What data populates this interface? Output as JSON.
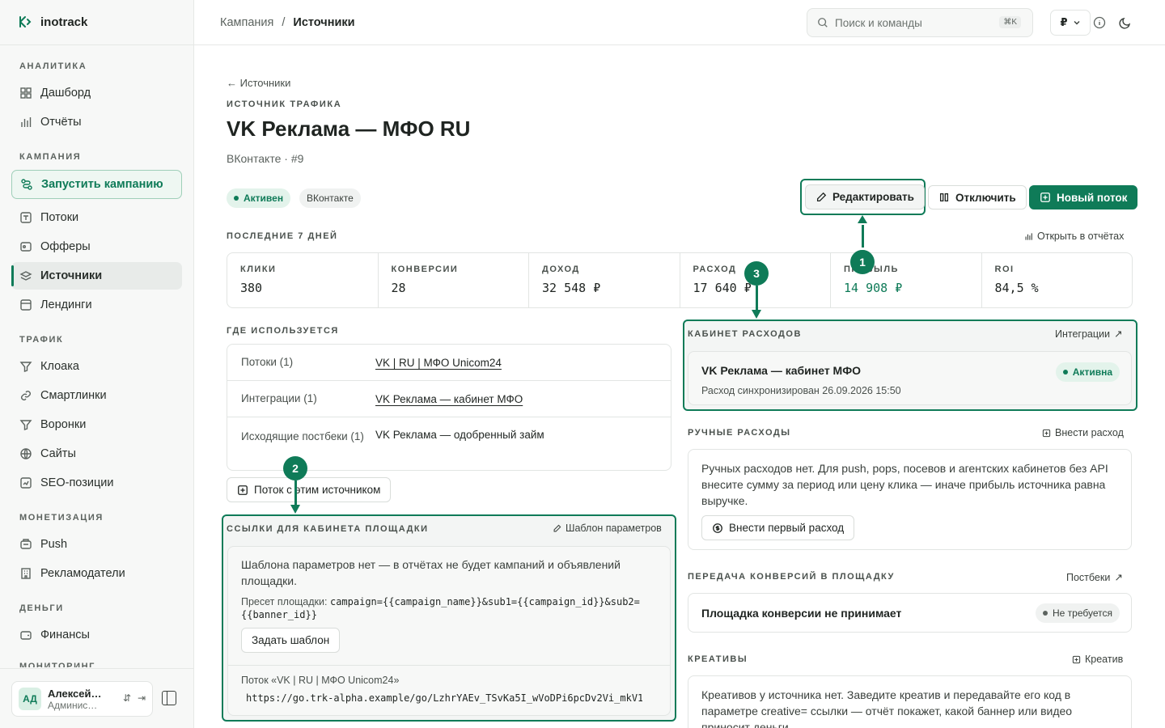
{
  "app": {
    "name": "inotrack"
  },
  "sidebar": {
    "sections": [
      {
        "title": "АНАЛИТИКА"
      },
      {
        "title": "КАМПАНИЯ"
      },
      {
        "title": "ТРАФИК"
      },
      {
        "title": "МОНЕТИЗАЦИЯ"
      },
      {
        "title": "ДЕНЬГИ"
      },
      {
        "title": "МОНИТОРИНГ"
      }
    ],
    "items": {
      "dashboard": "Дашборд",
      "reports": "Отчёты",
      "launch": "Запустить кампанию",
      "flows": "Потоки",
      "offers": "Офферы",
      "sources": "Источники",
      "landings": "Лендинги",
      "cloaking": "Клоака",
      "smartlinks": "Смартлинки",
      "funnels": "Воронки",
      "sites": "Сайты",
      "seo": "SEO-позиции",
      "push": "Push",
      "advertisers": "Рекламодатели",
      "finance": "Финансы"
    },
    "user": {
      "initials": "АД",
      "name": "Алексей…",
      "role": "Админис…"
    }
  },
  "topbar": {
    "breadcrumb": [
      "Кампания",
      "Источники"
    ],
    "search_placeholder": "Поиск и команды",
    "search_shortcut": "⌘K",
    "currency": "₽"
  },
  "page": {
    "back": "Источники",
    "eyebrow": "ИСТОЧНИК ТРАФИКА",
    "title": "VK Реклама — МФО RU",
    "subtitle": "ВКонтакте · #9",
    "badges": {
      "status": "Активен",
      "platform": "ВКонтакте"
    },
    "actions": {
      "edit": "Редактировать",
      "disable": "Отключить",
      "new_flow": "Новый поток"
    }
  },
  "stats": {
    "label": "ПОСЛЕДНИЕ 7 ДНЕЙ",
    "open_reports": "Открыть в отчётах",
    "items": [
      {
        "label": "КЛИКИ",
        "value": "380"
      },
      {
        "label": "КОНВЕРСИИ",
        "value": "28"
      },
      {
        "label": "ДОХОД",
        "value": "32 548 ₽"
      },
      {
        "label": "РАСХОД",
        "value": "17 640 ₽"
      },
      {
        "label": "ПРИБЫЛЬ",
        "value": "14 908 ₽"
      },
      {
        "label": "ROI",
        "value": "84,5 %"
      }
    ]
  },
  "usage": {
    "label": "ГДЕ ИСПОЛЬЗУЕТСЯ",
    "rows": [
      {
        "key": "Потоки (1)",
        "value": "VK | RU | МФО Unicom24"
      },
      {
        "key": "Интеграции (1)",
        "value": "VK Реклама — кабинет МФО"
      },
      {
        "key": "Исходящие постбеки (1)",
        "value": "VK Реклама — одобренный займ"
      }
    ],
    "flow_button": "Поток с этим источником"
  },
  "links": {
    "label": "ССЫЛКИ ДЛЯ КАБИНЕТА ПЛОЩАДКИ",
    "template_link": "Шаблон параметров",
    "empty_text": "Шаблона параметров нет — в отчётах не будет кампаний и объявлений площадки.",
    "preset_label": "Пресет площадки:",
    "preset_value": "campaign={{campaign_name}}&sub1={{campaign_id}}&sub2={{banner_id}}",
    "set_template": "Задать шаблон",
    "flow_label": "Поток «VK | RU | МФО Unicom24»",
    "flow_url": "https://go.trk-alpha.example/go/LzhrYAEv_TSvKa5I_wVoDPi6pcDv2Vi_mkV1…"
  },
  "expense_cabinet": {
    "label": "КАБИНЕТ РАСХОДОВ",
    "link": "Интеграции",
    "name": "VK Реклама — кабинет МФО",
    "status": "Активна",
    "sync": "Расход синхронизирован 26.09.2026 15:50"
  },
  "manual": {
    "label": "РУЧНЫЕ РАСХОДЫ",
    "link": "Внести расход",
    "text": "Ручных расходов нет. Для push, pops, посевов и агентских кабинетов без API внесите сумму за период или цену клика — иначе прибыль источника равна выручке.",
    "button": "Внести первый расход"
  },
  "conversions": {
    "label": "ПЕРЕДАЧА КОНВЕРСИЙ В ПЛОЩАДКУ",
    "link": "Постбеки",
    "text": "Площадка конверсии не принимает",
    "status": "Не требуется"
  },
  "creatives": {
    "label": "КРЕАТИВЫ",
    "link": "Креатив",
    "text": "Креативов у источника нет. Заведите креатив и передавайте его код в параметре creative= ссылки — отчёт покажет, какой баннер или видео приносит деньги."
  },
  "markers": [
    "1",
    "2",
    "3"
  ],
  "colors": {
    "accent": "#0f7b58",
    "accent_light": "#e3f3eb"
  }
}
